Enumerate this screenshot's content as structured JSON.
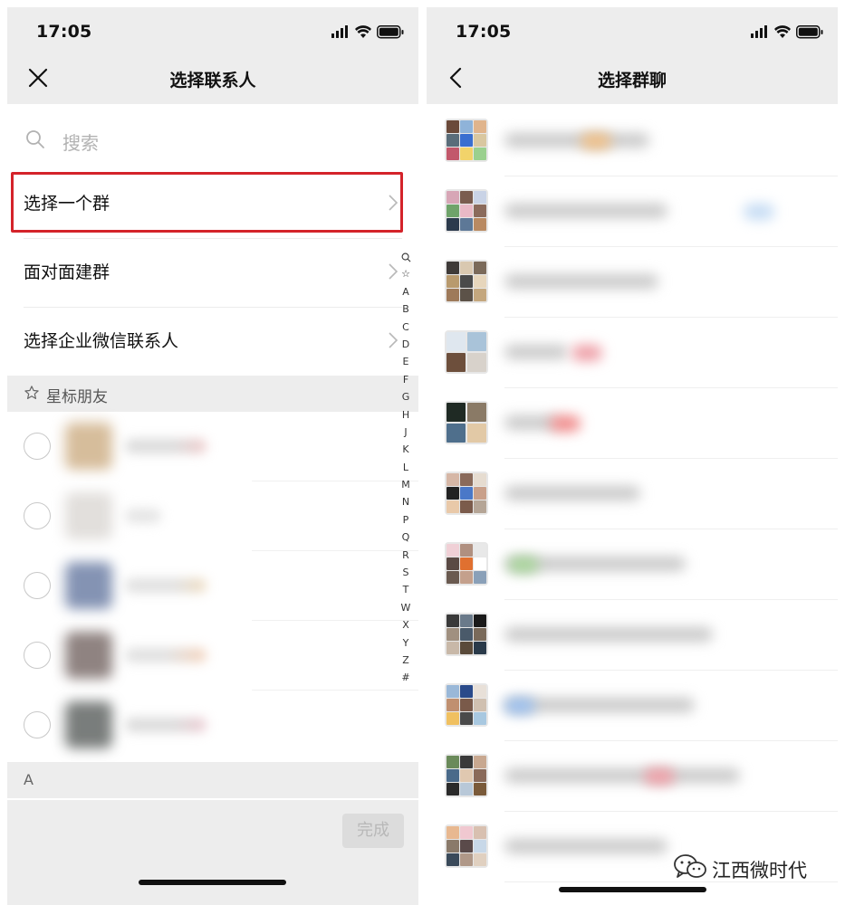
{
  "left_screen": {
    "status": {
      "time": "17:05"
    },
    "nav": {
      "title": "选择联系人"
    },
    "search": {
      "placeholder": "搜索"
    },
    "menu": [
      {
        "label": "选择一个群",
        "highlighted": true
      },
      {
        "label": "面对面建群",
        "highlighted": false
      },
      {
        "label": "选择企业微信联系人",
        "highlighted": false
      }
    ],
    "starred_header": "星标朋友",
    "contacts_count": 5,
    "index_letters": [
      "Q",
      "☆",
      "A",
      "B",
      "C",
      "D",
      "E",
      "F",
      "G",
      "H",
      "J",
      "K",
      "L",
      "M",
      "N",
      "P",
      "Q",
      "R",
      "S",
      "T",
      "W",
      "X",
      "Y",
      "Z",
      "#"
    ],
    "section_letter": "A",
    "done_button": "完成"
  },
  "right_screen": {
    "status": {
      "time": "17:05"
    },
    "nav": {
      "title": "选择群聊"
    },
    "groups_visible": 11
  },
  "watermark": {
    "text": "江西微时代"
  },
  "colors": {
    "highlight": "#d4232a",
    "header_bg": "#ededed",
    "done_disabled_bg": "#dcdcdc"
  }
}
